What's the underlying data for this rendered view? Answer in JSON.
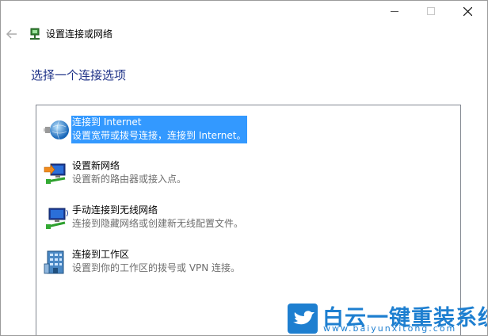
{
  "window": {
    "title": "设置连接或网络",
    "controls": [
      "minimize",
      "maximize",
      "close"
    ]
  },
  "instruction": "选择一个连接选项",
  "options": [
    {
      "title": "连接到 Internet",
      "description": "设置宽带或拨号连接，连接到 Internet。",
      "icon": "globe-network-icon",
      "selected": true
    },
    {
      "title": "设置新网络",
      "description": "设置新的路由器或接入点。",
      "icon": "new-network-icon",
      "selected": false
    },
    {
      "title": "手动连接到无线网络",
      "description": "连接到隐藏网络或创建新无线配置文件。",
      "icon": "wireless-network-icon",
      "selected": false
    },
    {
      "title": "连接到工作区",
      "description": "设置到你的工作区的拨号或 VPN 连接。",
      "icon": "workplace-icon",
      "selected": false
    }
  ],
  "watermark": {
    "title": "白云一键重装系统",
    "url": "www.baiyunxitong.com",
    "icon": "bird-logo-icon"
  },
  "colors": {
    "selection": "#3399ff",
    "instruction": "#1e3287",
    "watermark": "#1e7fd0"
  }
}
